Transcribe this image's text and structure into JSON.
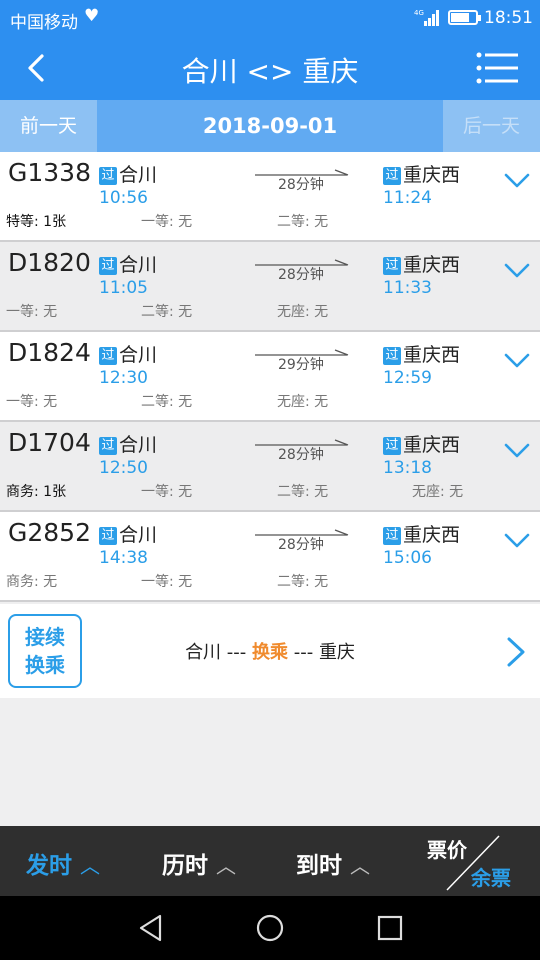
{
  "status_bar": {
    "carrier": "中国移动",
    "network": "4G",
    "time": "18:51",
    "heart_icon": "heart-icon"
  },
  "header": {
    "title": "合川 <> 重庆",
    "back_icon": "back-arrow-icon",
    "menu_icon": "menu-icon"
  },
  "date_bar": {
    "prev_label": "前一天",
    "date": "2018-09-01",
    "next_label": "后一天"
  },
  "pass_tag": "过",
  "trains": [
    {
      "number": "G1338",
      "from": "合川",
      "depart": "10:56",
      "duration": "28分钟",
      "to": "重庆西",
      "arrive": "11:24",
      "seats": [
        {
          "text": "特等: 1张",
          "available": true
        },
        {
          "text": "一等: 无",
          "available": false
        },
        {
          "text": "二等: 无",
          "available": false
        }
      ]
    },
    {
      "number": "D1820",
      "from": "合川",
      "depart": "11:05",
      "duration": "28分钟",
      "to": "重庆西",
      "arrive": "11:33",
      "seats": [
        {
          "text": "一等: 无",
          "available": false
        },
        {
          "text": "二等: 无",
          "available": false
        },
        {
          "text": "无座: 无",
          "available": false
        }
      ]
    },
    {
      "number": "D1824",
      "from": "合川",
      "depart": "12:30",
      "duration": "29分钟",
      "to": "重庆西",
      "arrive": "12:59",
      "seats": [
        {
          "text": "一等: 无",
          "available": false
        },
        {
          "text": "二等: 无",
          "available": false
        },
        {
          "text": "无座: 无",
          "available": false
        }
      ]
    },
    {
      "number": "D1704",
      "from": "合川",
      "depart": "12:50",
      "duration": "28分钟",
      "to": "重庆西",
      "arrive": "13:18",
      "seats": [
        {
          "text": "商务: 1张",
          "available": true
        },
        {
          "text": "一等: 无",
          "available": false
        },
        {
          "text": "二等: 无",
          "available": false
        },
        {
          "text": "无座: 无",
          "available": false
        }
      ]
    },
    {
      "number": "G2852",
      "from": "合川",
      "depart": "14:38",
      "duration": "28分钟",
      "to": "重庆西",
      "arrive": "15:06",
      "seats": [
        {
          "text": "商务: 无",
          "available": false
        },
        {
          "text": "一等: 无",
          "available": false
        },
        {
          "text": "二等: 无",
          "available": false
        }
      ]
    }
  ],
  "transfer": {
    "badge_line1": "接续",
    "badge_line2": "换乘",
    "from": "合川",
    "sep1": " --- ",
    "middle": "换乘",
    "sep2": " --- ",
    "to": "重庆"
  },
  "sort_bar": {
    "depart_label": "发时",
    "duration_label": "历时",
    "arrive_label": "到时",
    "price_label": "票价",
    "remaining_label": "余票",
    "active": "depart"
  },
  "colors": {
    "primary": "#2d8ff0",
    "accent": "#2b9ee8",
    "highlight": "#f08b2e",
    "sortbar": "#2f2f2f"
  }
}
